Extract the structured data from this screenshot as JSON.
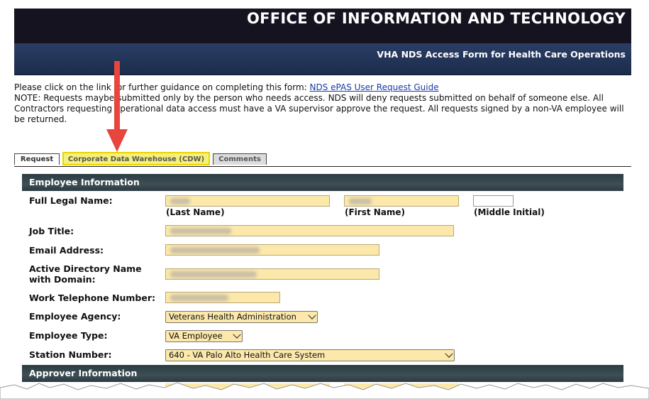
{
  "header": {
    "title": "OFFICE OF INFORMATION AND TECHNOLOGY",
    "subtitle": "VHA NDS Access Form for Health Care Operations"
  },
  "intro": {
    "line1_prefix": "Please click on the link for further guidance on completing this form: ",
    "guide_link": "NDS ePAS User Request Guide",
    "note": "NOTE: Requests maybe submitted only by the person who needs access. NDS will deny requests submitted on behalf of someone else. All Contractors requesting operational data access must have a VA supervisor approve the request. All requests signed by a non-VA employee will be returned."
  },
  "tabs": [
    {
      "label": "Request"
    },
    {
      "label": "Corporate Data Warehouse (CDW)"
    },
    {
      "label": "Comments"
    }
  ],
  "sections": {
    "employee": "Employee Information",
    "approver": "Approver Information"
  },
  "form": {
    "full_name_label": "Full Legal Name:",
    "last_name_caption": "(Last Name)",
    "first_name_caption": "(First Name)",
    "middle_initial_caption": "(Middle Initial)",
    "job_title_label": "Job Title:",
    "email_label": "Email Address:",
    "ad_name_label_line1": "Active Directory Name",
    "ad_name_label_line2": "with Domain:",
    "phone_label": "Work Telephone Number:",
    "agency_label": "Employee Agency:",
    "agency_value": "Veterans Health Administration",
    "type_label": "Employee Type:",
    "type_value": "VA Employee",
    "station_label": "Station Number:",
    "station_value": "640 - VA Palo Alto Health Care System"
  },
  "colors": {
    "field_bg": "#fbe8aa",
    "highlight_tab": "#f5f07a",
    "arrow": "#e8453c",
    "header_dark": "#15131f",
    "header_blue": "#22355a"
  }
}
